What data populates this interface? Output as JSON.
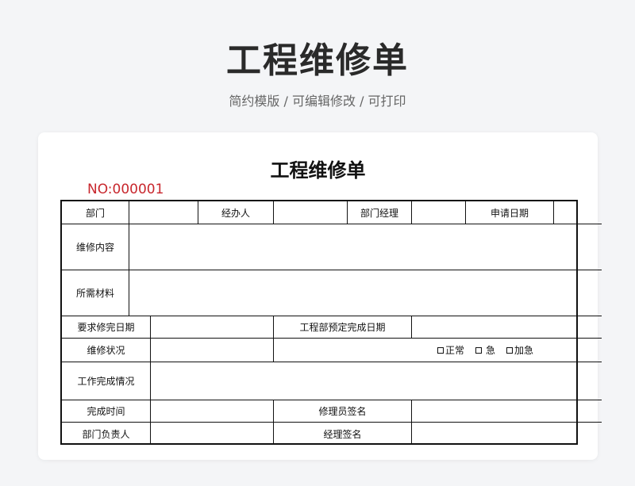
{
  "header": {
    "title": "工程维修单",
    "subtitle": "简约模版 /  可编辑修改  / 可打印"
  },
  "form": {
    "title": "工程维修单",
    "number": "NO:000001",
    "labels": {
      "department": "部门",
      "handler": "经办人",
      "dept_manager": "部门经理",
      "apply_date": "申请日期",
      "repair_content": "维修内容",
      "materials": "所需材料",
      "required_date": "要求修完日期",
      "planned_date": "工程部预定完成日期",
      "repair_status": "维修状况",
      "completion_status": "工作完成情况",
      "completion_time": "完成时间",
      "repairer_sign": "修理员签名",
      "dept_head": "部门负责人",
      "manager_sign": "经理签名"
    },
    "status_options": [
      "正常",
      "急",
      "加急"
    ]
  }
}
